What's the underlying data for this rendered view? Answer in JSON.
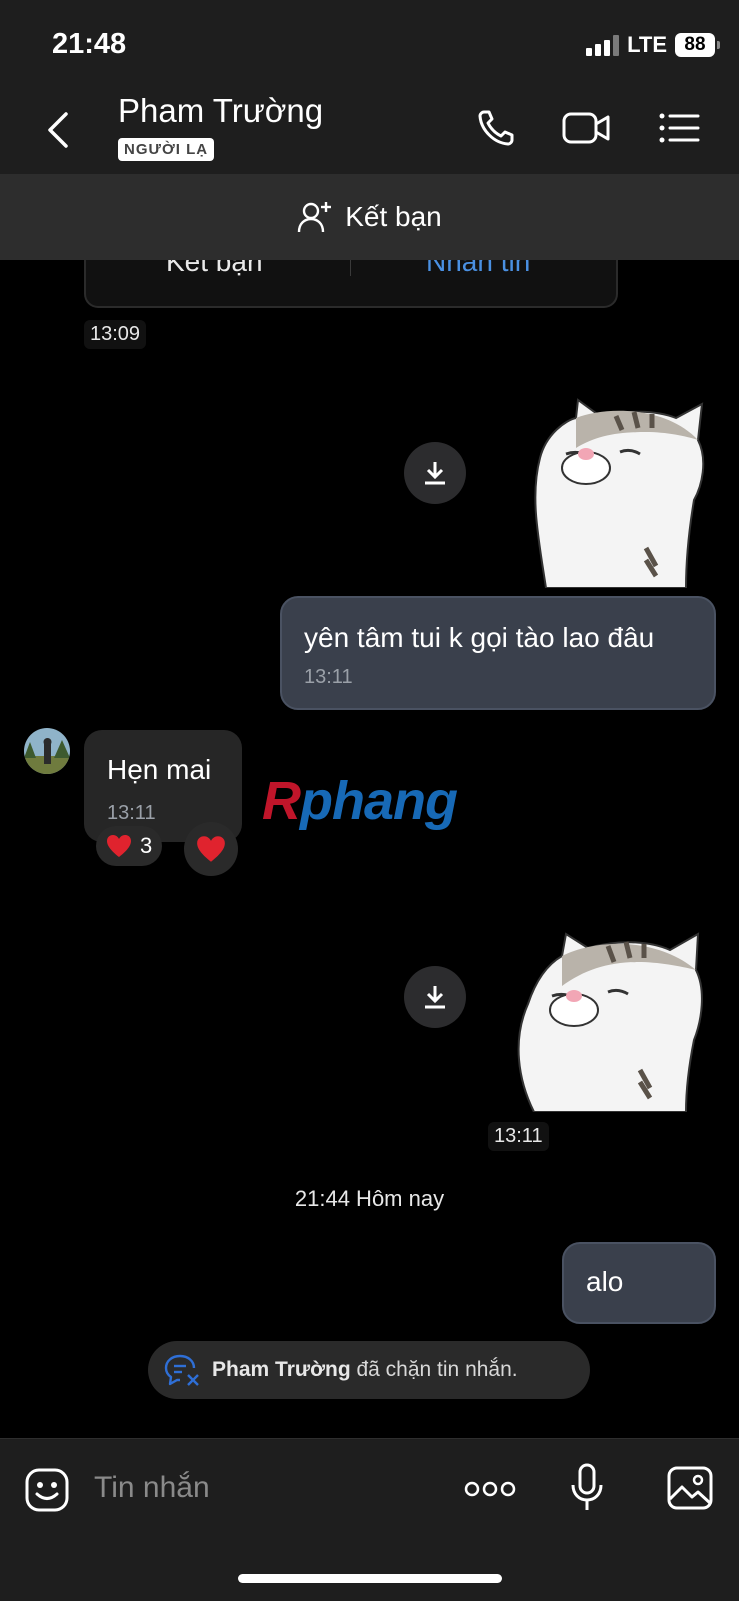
{
  "status_bar": {
    "time": "21:48",
    "network": "LTE",
    "battery": "88"
  },
  "header": {
    "contact_name": "Pham Trường",
    "badge": "NGƯỜI LẠ"
  },
  "add_friend_bar": {
    "label": "Kết bạn"
  },
  "card_remnant": {
    "left_label": "Kết bạn",
    "right_label": "Nhắn tin",
    "time": "13:09"
  },
  "messages": {
    "outgoing_1": {
      "text": "yên tâm tui k gọi tào lao đâu",
      "time": "13:11"
    },
    "incoming_1": {
      "text": "Hẹn mai",
      "time": "13:11",
      "reaction_count": "3"
    },
    "sticker_2_time": "13:11",
    "outgoing_2": {
      "text": "alo"
    }
  },
  "date_separator": "21:44 Hôm nay",
  "blocked_notice": {
    "name": "Pham Trường",
    "text": " đã chặn tin nhắn."
  },
  "watermark": {
    "first": "R",
    "rest": "phang"
  },
  "composer": {
    "placeholder": "Tin nhắn"
  },
  "colors": {
    "accent": "#4a90e2",
    "outgoing_bubble": "#3a404c",
    "incoming_bubble": "#262626",
    "heart": "#e0232e"
  }
}
